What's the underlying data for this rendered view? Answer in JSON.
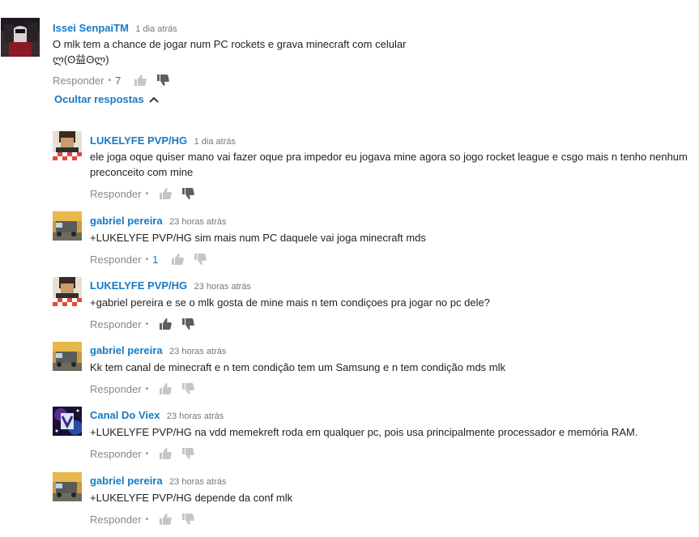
{
  "top_comment": {
    "author": "Issei SenpaiTM",
    "time": "1 dia atrás",
    "text_line1": "O mlk tem a chance de jogar num PC rockets e grava minecraft com celular",
    "text_line2": "ლ(ʘ益ʘლ)",
    "reply_label": "Responder",
    "likes": "7",
    "hide_replies_label": "Ocultar respostas"
  },
  "replies": [
    {
      "author": "LUKELYFE PVP/HG",
      "time": "1 dia atrás",
      "text": "ele joga oque quiser mano vai fazer oque pra impedor eu jogava mine agora so jogo rocket league e csgo mais n tenho nenhum preconceito com mine",
      "reply_label": "Responder",
      "likes": ""
    },
    {
      "author": "gabriel pereira",
      "time": "23 horas atrás",
      "text": "+LUKELYFE PVP/HG  sim mais num PC daquele vai joga minecraft mds",
      "reply_label": "Responder",
      "likes": "1"
    },
    {
      "author": "LUKELYFE PVP/HG",
      "time": "23 horas atrás",
      "text": "+gabriel pereira  e se o mlk gosta de mine mais n tem condiçoes pra jogar no pc dele?",
      "reply_label": "Responder",
      "likes": ""
    },
    {
      "author": "gabriel pereira",
      "time": "23 horas atrás",
      "text": "Kk tem canal de minecraft e n tem condição tem um Samsung e n tem condição mds mlk",
      "reply_label": "Responder",
      "likes": ""
    },
    {
      "author": "Canal Do Viex",
      "time": "23 horas atrás",
      "text": "+LUKELYFE PVP/HG  na vdd memekreft roda em qualquer pc, pois usa principalmente processador e memória RAM.",
      "reply_label": "Responder",
      "likes": ""
    },
    {
      "author": "gabriel pereira",
      "time": "23 horas atrás",
      "text": "+LUKELYFE PVP/HG depende da conf mlk",
      "reply_label": "Responder",
      "likes": ""
    }
  ],
  "icons": {
    "like": "thumbs-up-icon",
    "dislike": "thumbs-down-icon",
    "chevron": "chevron-up-icon"
  },
  "colors": {
    "author": "#167ac6",
    "meta": "#767676",
    "text": "#222222"
  }
}
